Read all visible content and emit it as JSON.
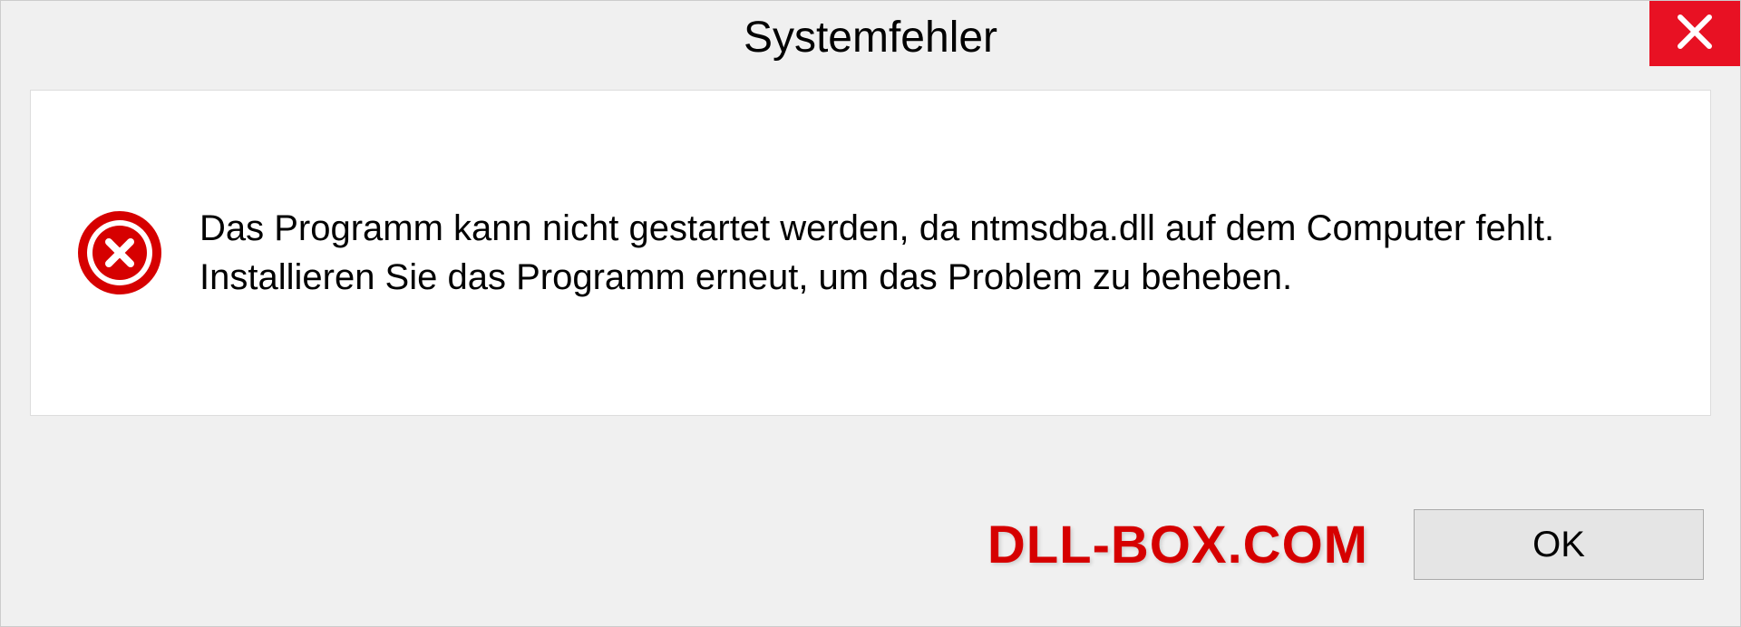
{
  "dialog": {
    "title": "Systemfehler",
    "message": "Das Programm kann nicht gestartet werden, da ntmsdba.dll auf dem Computer fehlt. Installieren Sie das Programm erneut, um das Problem zu beheben.",
    "ok_label": "OK"
  },
  "watermark": "DLL-BOX.COM"
}
